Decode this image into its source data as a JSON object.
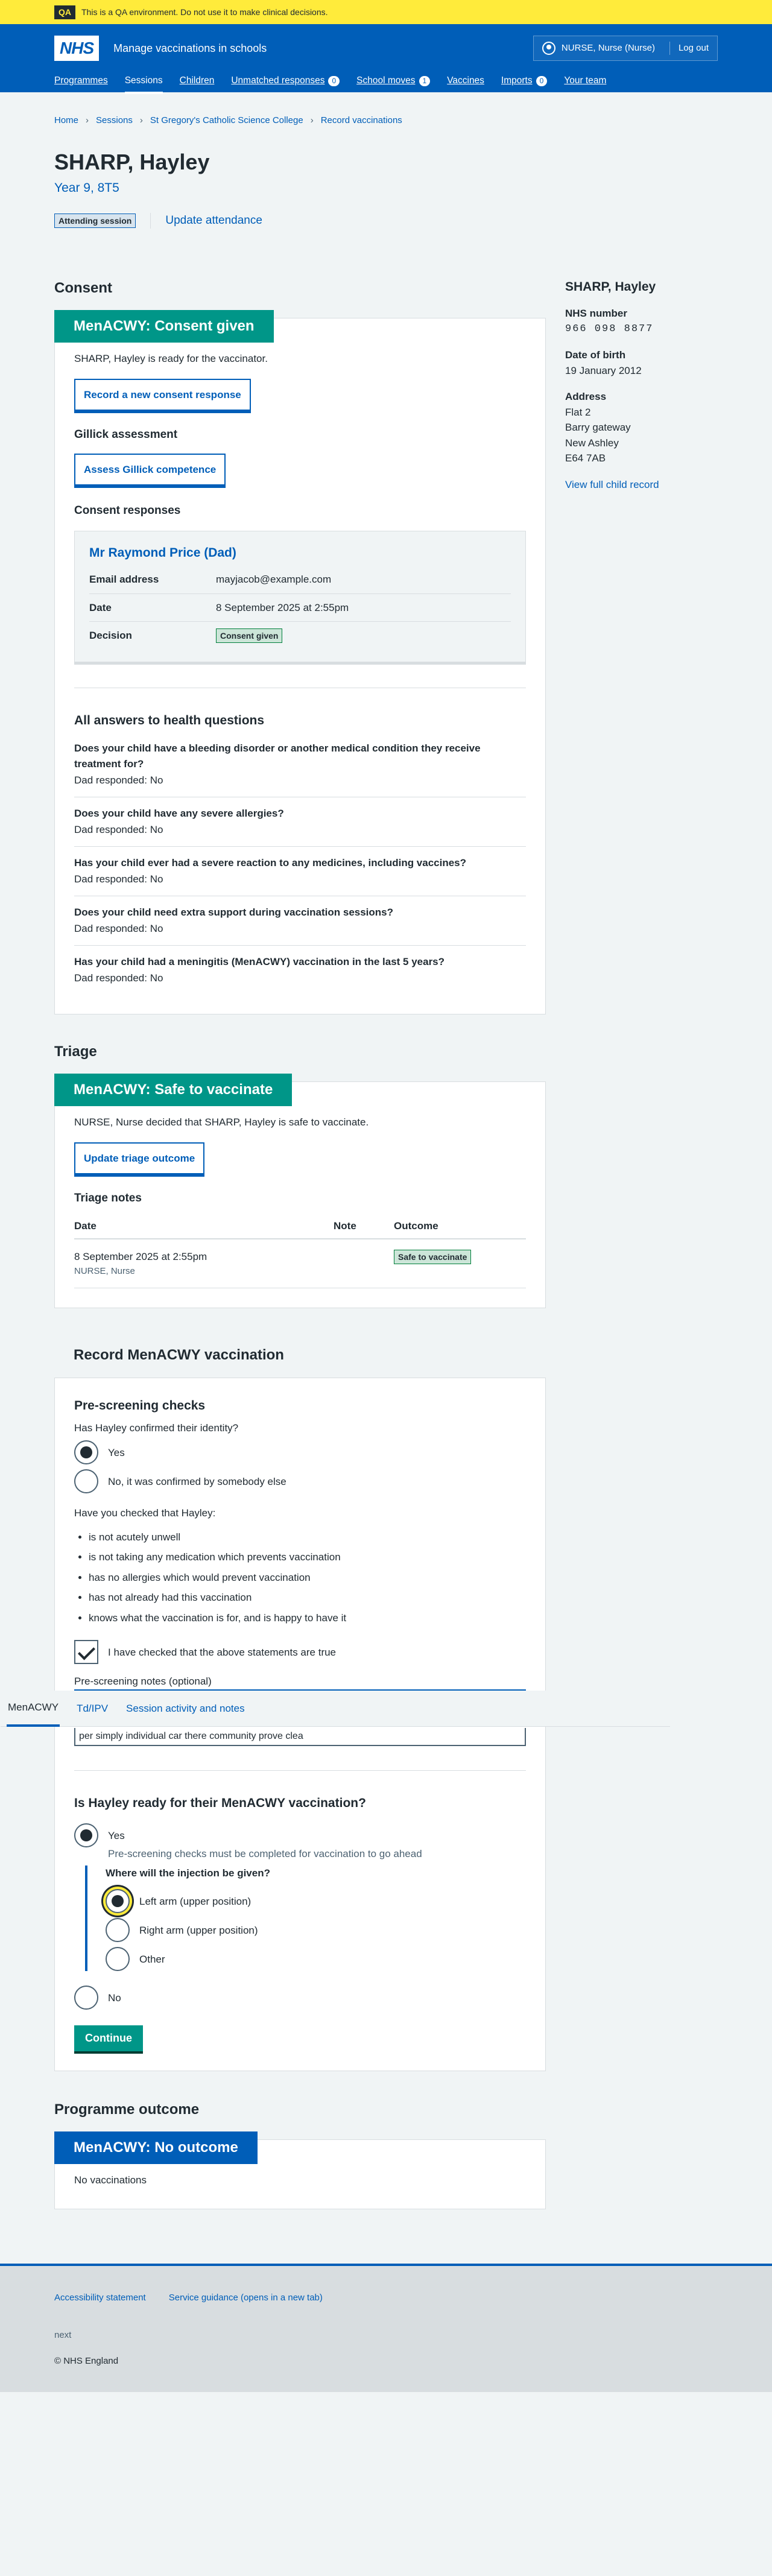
{
  "qa": {
    "tag": "QA",
    "text": "This is a QA environment. Do not use it to make clinical decisions."
  },
  "header": {
    "logo": "NHS",
    "service": "Manage vaccinations in schools",
    "user": "NURSE, Nurse (Nurse)",
    "logout": "Log out"
  },
  "nav": [
    {
      "label": "Programmes"
    },
    {
      "label": "Sessions"
    },
    {
      "label": "Children"
    },
    {
      "label": "Unmatched responses",
      "count": "0"
    },
    {
      "label": "School moves",
      "count": "1"
    },
    {
      "label": "Vaccines"
    },
    {
      "label": "Imports",
      "count": "0"
    },
    {
      "label": "Your team"
    }
  ],
  "breadcrumbs": [
    "Home",
    "Sessions",
    "St Gregory's Catholic Science College",
    "Record vaccinations"
  ],
  "patient": {
    "name": "SHARP, Hayley",
    "year": "Year 9, 8T5",
    "attending": "Attending session",
    "update_attendance": "Update attendance"
  },
  "consent": {
    "heading": "Consent",
    "card_title": "MenACWY: Consent given",
    "ready_text": "SHARP, Hayley is ready for the vaccinator.",
    "new_consent_button": "Record a new consent response",
    "gillick_heading": "Gillick assessment",
    "gillick_button": "Assess Gillick competence",
    "responses_heading": "Consent responses",
    "response": {
      "parent": "Mr Raymond Price (Dad)",
      "email_label": "Email address",
      "email": "mayjacob@example.com",
      "date_label": "Date",
      "date": "8 September 2025 at 2:55pm",
      "decision_label": "Decision",
      "decision": "Consent given"
    },
    "health_heading": "All answers to health questions",
    "questions": [
      {
        "q": "Does your child have a bleeding disorder or another medical condition they receive treatment for?",
        "a": "Dad responded: No"
      },
      {
        "q": "Does your child have any severe allergies?",
        "a": "Dad responded: No"
      },
      {
        "q": "Has your child ever had a severe reaction to any medicines, including vaccines?",
        "a": "Dad responded: No"
      },
      {
        "q": "Does your child need extra support during vaccination sessions?",
        "a": "Dad responded: No"
      },
      {
        "q": "Has your child had a meningitis (MenACWY) vaccination in the last 5 years?",
        "a": "Dad responded: No"
      }
    ]
  },
  "triage": {
    "heading": "Triage",
    "card_title": "MenACWY: Safe to vaccinate",
    "text": "NURSE, Nurse decided that SHARP, Hayley is safe to vaccinate.",
    "update_button": "Update triage outcome",
    "notes_heading": "Triage notes",
    "col_date": "Date",
    "col_note": "Note",
    "col_outcome": "Outcome",
    "row_date": "8 September 2025 at 2:55pm",
    "row_by": "NURSE, Nurse",
    "row_outcome": "Safe to vaccinate"
  },
  "record": {
    "heading": "Record MenACWY vaccination",
    "pre_heading": "Pre-screening checks",
    "identity_q": "Has Hayley confirmed their identity?",
    "identity_yes": "Yes",
    "identity_no": "No, it was confirmed by somebody else",
    "checked_q": "Have you checked that Hayley:",
    "checks": [
      "is not acutely unwell",
      "is not taking any medication which prevents vaccination",
      "has no allergies which would prevent vaccination",
      "has not already had this vaccination",
      "knows what the vaccination is for, and is happy to have it"
    ],
    "confirm_label": "I have checked that the above statements are true",
    "notes_label": "Pre-screening notes (optional)",
    "notes_value": "per simply individual car there community prove clea",
    "ready_q": "Is Hayley ready for their MenACWY vaccination?",
    "ready_yes": "Yes",
    "ready_hint": "Pre-screening checks must be completed for vaccination to go ahead",
    "site_q": "Where will the injection be given?",
    "site_left": "Left arm (upper position)",
    "site_right": "Right arm (upper position)",
    "site_other": "Other",
    "ready_no": "No",
    "continue": "Continue"
  },
  "tabs": [
    "MenACWY",
    "Td/IPV",
    "Session activity and notes"
  ],
  "outcome": {
    "heading": "Programme outcome",
    "card_title": "MenACWY: No outcome",
    "text": "No vaccinations"
  },
  "aside": {
    "name": "SHARP, Hayley",
    "nhs_label": "NHS number",
    "nhs": "966 098 8877",
    "dob_label": "Date of birth",
    "dob": "19 January 2012",
    "address_label": "Address",
    "address": [
      "Flat 2",
      "Barry gateway",
      "New Ashley",
      "E64 7AB"
    ],
    "link": "View full child record"
  },
  "footer": {
    "links": [
      "Accessibility statement",
      "Service guidance (opens in a new tab)"
    ],
    "version": "next",
    "copyright": "© NHS England"
  }
}
